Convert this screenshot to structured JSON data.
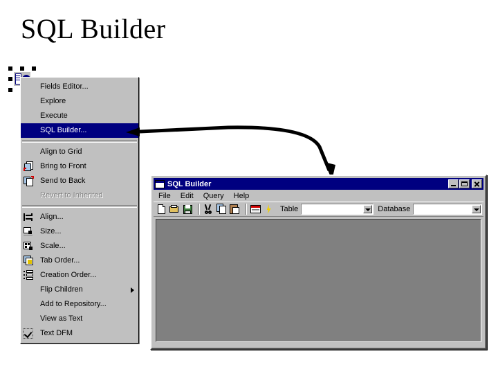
{
  "slide": {
    "title": "SQL Builder"
  },
  "component": {
    "icon_name": "dataset-component-icon",
    "handle_count": 8
  },
  "context_menu": {
    "items": [
      {
        "label": "Fields Editor...",
        "icon": "",
        "state": "normal",
        "type": "item"
      },
      {
        "label": "Explore",
        "icon": "",
        "state": "normal",
        "type": "item"
      },
      {
        "label": "Execute",
        "icon": "",
        "state": "normal",
        "type": "item"
      },
      {
        "label": "SQL Builder...",
        "icon": "",
        "state": "selected",
        "type": "item"
      },
      {
        "label": "",
        "icon": "",
        "state": "normal",
        "type": "separator"
      },
      {
        "label": "Align to Grid",
        "icon": "",
        "state": "normal",
        "type": "item"
      },
      {
        "label": "Bring to Front",
        "icon": "bring-to-front-icon",
        "state": "normal",
        "type": "item"
      },
      {
        "label": "Send to Back",
        "icon": "send-to-back-icon",
        "state": "normal",
        "type": "item"
      },
      {
        "label": "Revert to Inherited",
        "icon": "",
        "state": "disabled",
        "type": "item"
      },
      {
        "label": "",
        "icon": "",
        "state": "normal",
        "type": "separator"
      },
      {
        "label": "Align...",
        "icon": "align-icon",
        "state": "normal",
        "type": "item"
      },
      {
        "label": "Size...",
        "icon": "size-icon",
        "state": "normal",
        "type": "item"
      },
      {
        "label": "Scale...",
        "icon": "scale-icon",
        "state": "normal",
        "type": "item"
      },
      {
        "label": "Tab Order...",
        "icon": "tab-order-icon",
        "state": "normal",
        "type": "item"
      },
      {
        "label": "Creation Order...",
        "icon": "creation-order-icon",
        "state": "normal",
        "type": "item"
      },
      {
        "label": "Flip Children",
        "icon": "",
        "state": "normal",
        "type": "submenu"
      },
      {
        "label": "Add to Repository...",
        "icon": "",
        "state": "normal",
        "type": "item"
      },
      {
        "label": "View as Text",
        "icon": "",
        "state": "normal",
        "type": "item"
      },
      {
        "label": "Text DFM",
        "icon": "",
        "state": "checked",
        "type": "checkitem"
      }
    ]
  },
  "annotation": {
    "name": "callout-arrow",
    "color": "#000000"
  },
  "sql_builder": {
    "title": "SQL Builder",
    "window_buttons": [
      {
        "name": "minimize-button",
        "glyph": "minimize-icon"
      },
      {
        "name": "maximize-button",
        "glyph": "maximize-icon"
      },
      {
        "name": "close-button",
        "glyph": "close-icon"
      }
    ],
    "menubar": [
      {
        "label": "File",
        "accel": "F"
      },
      {
        "label": "Edit",
        "accel": "E"
      },
      {
        "label": "Query",
        "accel": "Q"
      },
      {
        "label": "Help",
        "accel": "H"
      }
    ],
    "toolbar": {
      "buttons": [
        {
          "name": "new-button",
          "icon": "new-document-icon"
        },
        {
          "name": "open-button",
          "icon": "open-folder-icon"
        },
        {
          "name": "save-button",
          "icon": "save-disk-icon"
        },
        {
          "name": "cut-button",
          "icon": "scissors-icon"
        },
        {
          "name": "copy-button",
          "icon": "copy-icon"
        },
        {
          "name": "paste-button",
          "icon": "paste-clipboard-icon"
        },
        {
          "name": "sql-button",
          "icon": "sql-icon"
        },
        {
          "name": "execute-button",
          "icon": "lightning-bolt-icon"
        }
      ],
      "table_label": "Table",
      "table_value": "",
      "table_placeholder": "",
      "database_label": "Database",
      "database_value": "",
      "database_placeholder": ""
    },
    "client_area": {
      "name": "query-design-surface",
      "content": "",
      "background": "#808080"
    }
  },
  "colors": {
    "menu_highlight": "#000080",
    "face": "#c0c0c0",
    "titlebar": "#000080",
    "client": "#808080",
    "white": "#ffffff",
    "shadow": "#808080"
  }
}
